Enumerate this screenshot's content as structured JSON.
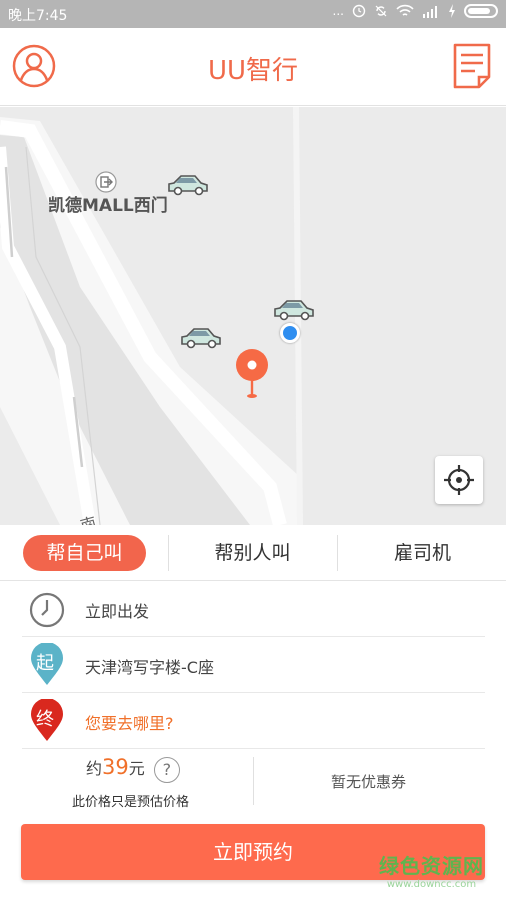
{
  "status_bar": {
    "time": "晚上7:45",
    "icons": [
      "more-dots-icon",
      "alarm-icon",
      "sync-icon",
      "wifi-icon",
      "signal-icon",
      "charging-icon",
      "battery-icon"
    ],
    "more_dots": "..."
  },
  "header": {
    "title": "UU智行",
    "avatar_icon": "user-avatar-icon",
    "orders_icon": "order-list-icon"
  },
  "map": {
    "poi_label": "凯德MALL西门",
    "poi_icon": "entrance-icon",
    "road_text": "南",
    "cars": [
      "car-icon",
      "car-icon",
      "car-icon"
    ],
    "current_location_icon": "current-location-dot",
    "pickup_pin_icon": "pickup-pin-icon",
    "locate_button_icon": "locate-crosshair-icon"
  },
  "tabs": [
    {
      "label": "帮自己叫",
      "active": true
    },
    {
      "label": "帮别人叫",
      "active": false
    },
    {
      "label": "雇司机",
      "active": false
    }
  ],
  "trip": {
    "time_label": "立即出发",
    "start_badge": "起",
    "start_label": "天津湾写字楼-C座",
    "end_badge": "终",
    "end_placeholder": "您要去哪里?"
  },
  "price": {
    "prefix": "约",
    "amount": "39",
    "unit": "元",
    "help": "?",
    "note": "此价格只是预估价格",
    "coupon": "暂无优惠券"
  },
  "book_button": "立即预约",
  "watermark": {
    "line1": "绿色资源网",
    "line2": "www.downcc.com"
  },
  "colors": {
    "accent": "#f2654c",
    "start_badge": "#5bb3c8",
    "end_badge": "#d9281e",
    "statusbar": "#b5b5b5"
  }
}
